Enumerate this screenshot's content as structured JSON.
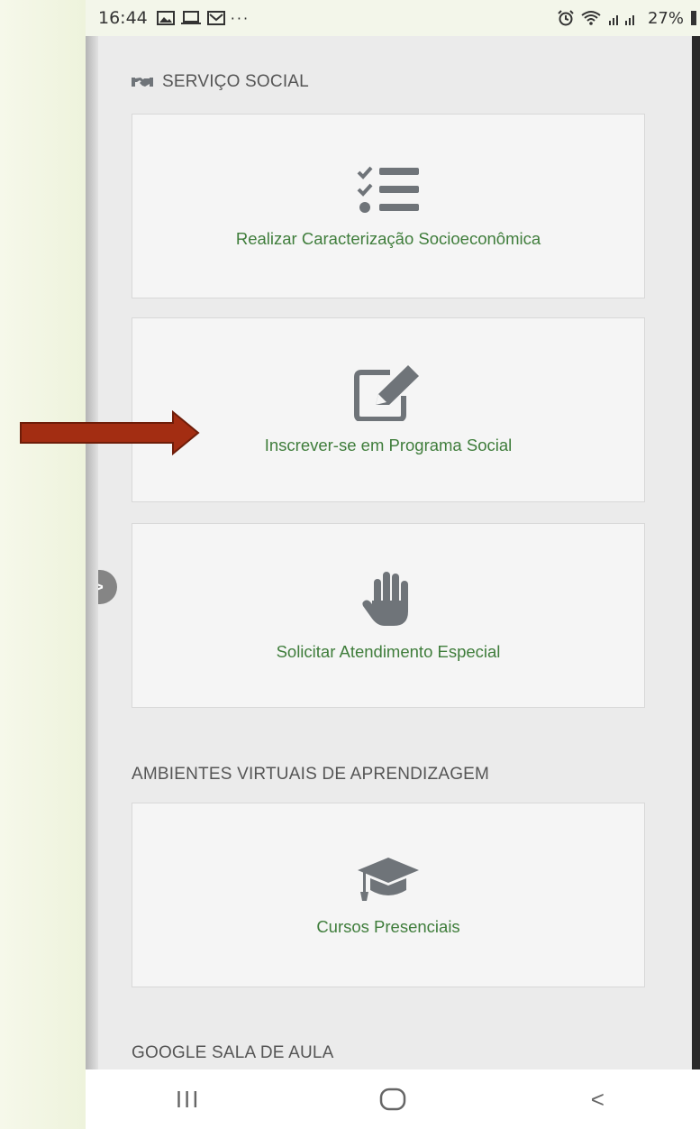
{
  "status_bar": {
    "time": "16:44",
    "dots": "···",
    "battery": "27%"
  },
  "sections": [
    {
      "title": "SERVIÇO SOCIAL",
      "icon": "handshake-icon",
      "cards": [
        {
          "label": "Realizar Caracterização Socioeconômica",
          "icon": "checklist-icon"
        },
        {
          "label": "Inscrever-se em Programa Social",
          "icon": "edit-icon"
        },
        {
          "label": "Solicitar Atendimento Especial",
          "icon": "hand-icon"
        }
      ]
    },
    {
      "title": "AMBIENTES VIRTUAIS DE APRENDIZAGEM",
      "cards": [
        {
          "label": "Cursos Presenciais",
          "icon": "graduation-cap-icon"
        }
      ]
    },
    {
      "title": "GOOGLE SALA DE AULA",
      "cards": []
    }
  ],
  "side_toggle": {
    "glyph": ">"
  },
  "navbar": {
    "recent": "III",
    "back": "<"
  },
  "colors": {
    "link_green": "#3f7d3b",
    "icon_gray": "#6f7479",
    "arrow_red": "#a32d12"
  }
}
